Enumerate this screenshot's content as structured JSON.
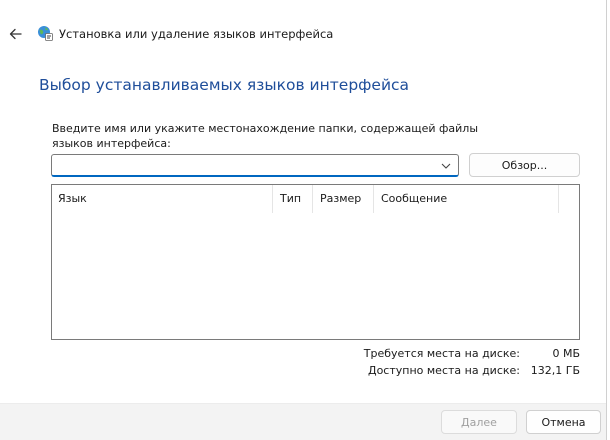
{
  "header": {
    "title": "Установка или удаление языков интерфейса",
    "back_icon": "arrow-left-icon",
    "wizard_icon": "globe-wizard-icon"
  },
  "main": {
    "heading": "Выбор устанавливаемых языков интерфейса",
    "instruction": "Введите имя или укажите местонахождение папки, содержащей файлы языков интерфейса:",
    "path_value": "",
    "browse_label": "Обзор...",
    "table": {
      "columns": [
        "Язык",
        "Тип",
        "Размер",
        "Сообщение"
      ],
      "rows": []
    }
  },
  "disk": {
    "required_label": "Требуется места на диске:",
    "required_value": "0 МБ",
    "available_label": "Доступно места на диске:",
    "available_value": "132,1 ГБ"
  },
  "footer": {
    "next_label": "Далее",
    "cancel_label": "Отмена"
  },
  "colors": {
    "heading": "#1f4e9a",
    "accent": "#0067c0",
    "footer_bg": "#f3f3f3"
  }
}
